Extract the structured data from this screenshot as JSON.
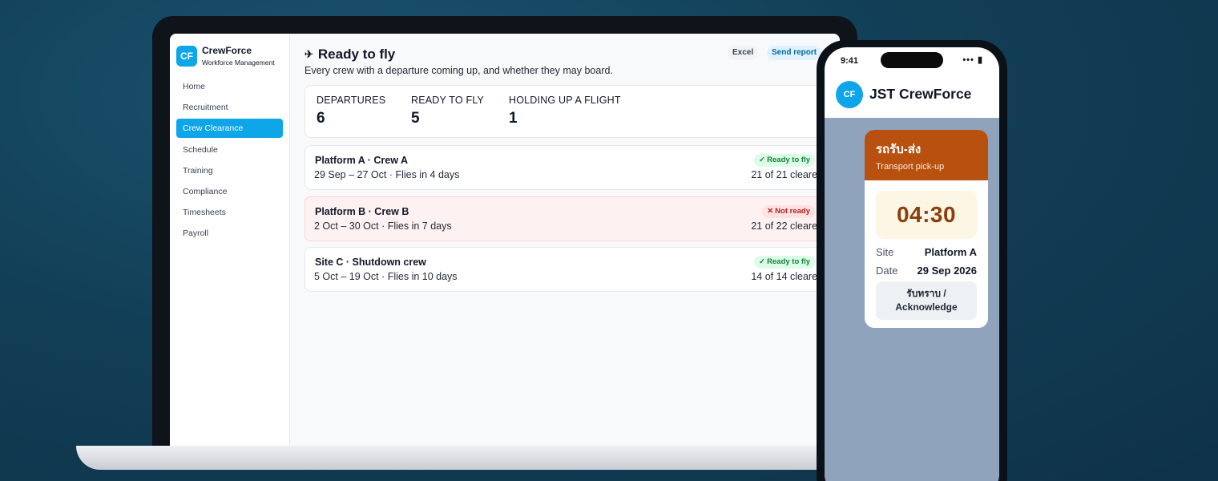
{
  "app": {
    "logo": "CF",
    "name": "CrewForce",
    "subtitle": "Workforce Management"
  },
  "sidebar": {
    "items": [
      {
        "label": "Home"
      },
      {
        "label": "Recruitment"
      },
      {
        "label": "Crew Clearance",
        "active": true
      },
      {
        "label": "Schedule"
      },
      {
        "label": "Training"
      },
      {
        "label": "Compliance"
      },
      {
        "label": "Timesheets"
      },
      {
        "label": "Payroll"
      }
    ]
  },
  "header": {
    "icon": "airplane-icon",
    "title": "Ready to fly",
    "subtitle": "Every crew with a departure coming up, and whether they may board.",
    "excel_label": "Excel",
    "send_label": "Send report"
  },
  "stats": [
    {
      "label": "DEPARTURES",
      "value": "6"
    },
    {
      "label": "READY TO FLY",
      "value": "5"
    },
    {
      "label": "HOLDING UP A FLIGHT",
      "value": "1"
    }
  ],
  "crews": [
    {
      "title": "Platform A · Crew A",
      "dates": "29 Sep – 27 Oct · Flies in 4 days",
      "status": "Ready to fly",
      "status_icon": "✓",
      "cleared": "21 of 21 cleared"
    },
    {
      "title": "Platform B · Crew B",
      "dates": "2 Oct – 30 Oct · Flies in 7 days",
      "status": "Not ready",
      "status_icon": "✕",
      "cleared": "21 of 22 cleared"
    },
    {
      "title": "Site C · Shutdown crew",
      "dates": "5 Oct – 19 Oct · Flies in 10 days",
      "status": "Ready to fly",
      "status_icon": "✓",
      "cleared": "14 of 14 cleared"
    }
  ],
  "phone": {
    "time": "9:41",
    "status_icons": "••• ▮",
    "avatar": "CF",
    "app_title": "JST CrewForce",
    "card": {
      "title": "รถรับ-ส่ง",
      "subtitle": "Transport pick-up",
      "time": "04:30",
      "site_label": "Site",
      "site_value": "Platform A",
      "date_label": "Date",
      "date_value": "29 Sep 2026",
      "ack_line1": "รับทราบ /",
      "ack_line2": "Acknowledge"
    }
  },
  "colors": {
    "accent": "#0ea5e9",
    "ok": "#15803d",
    "bad": "#b91c1c",
    "card_header": "#b8500f",
    "background": "#123f57"
  }
}
